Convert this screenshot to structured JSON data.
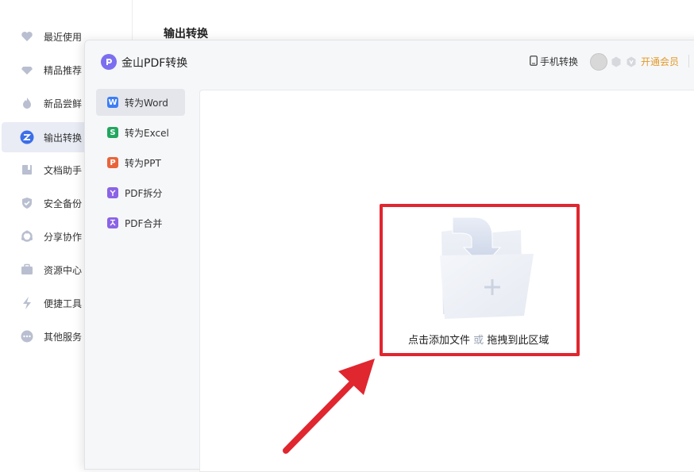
{
  "sidebar": {
    "items": [
      {
        "label": "最近使用",
        "icon": "heart-icon"
      },
      {
        "label": "精品推荐",
        "icon": "diamond-icon"
      },
      {
        "label": "新品尝鲜",
        "icon": "flame-icon"
      },
      {
        "label": "输出转换",
        "icon": "convert-icon",
        "active": true
      },
      {
        "label": "文档助手",
        "icon": "book-icon"
      },
      {
        "label": "安全备份",
        "icon": "shield-icon"
      },
      {
        "label": "分享协作",
        "icon": "share-icon"
      },
      {
        "label": "资源中心",
        "icon": "briefcase-icon"
      },
      {
        "label": "便捷工具",
        "icon": "lightning-icon"
      },
      {
        "label": "其他服务",
        "icon": "more-icon"
      }
    ]
  },
  "background": {
    "section_title": "输出转换"
  },
  "modal": {
    "app_title": "金山PDF转换",
    "mobile_convert": "手机转换",
    "vip_label": "开通会员",
    "menu": [
      {
        "label": "转为Word",
        "icon": "word-icon",
        "color": "#3d7ef5",
        "glyph": "W",
        "active": true
      },
      {
        "label": "转为Excel",
        "icon": "excel-icon",
        "color": "#22a660",
        "glyph": "S"
      },
      {
        "label": "转为PPT",
        "icon": "ppt-icon",
        "color": "#e8653a",
        "glyph": "P"
      },
      {
        "label": "PDF拆分",
        "icon": "split-icon",
        "color": "#8b63e6",
        "glyph": "⑂"
      },
      {
        "label": "PDF合并",
        "icon": "merge-icon",
        "color": "#8b63e6",
        "glyph": "⋏"
      }
    ],
    "drop_zone": {
      "click_text": "点击添加文件",
      "or_text": "或",
      "drag_text": "拖拽到此区域"
    }
  },
  "colors": {
    "accent": "#7b6ff0",
    "highlight": "#e0262f",
    "vip": "#e19a2a"
  }
}
